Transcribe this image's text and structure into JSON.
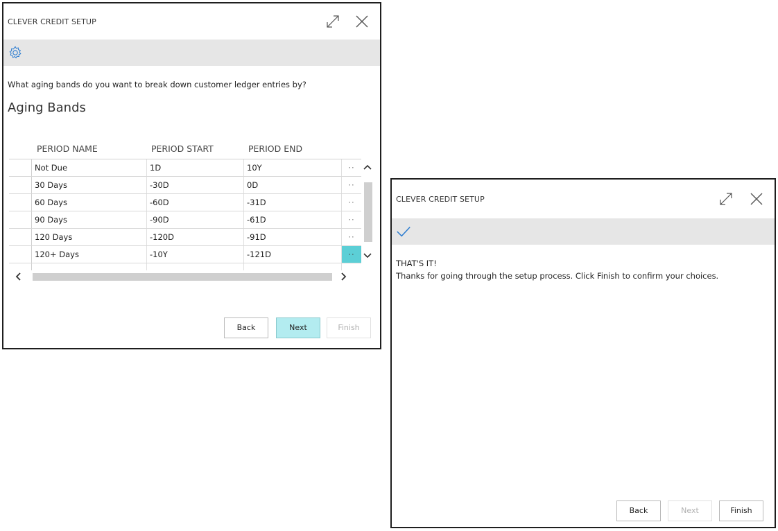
{
  "dialog1": {
    "title": "CLEVER CREDIT SETUP",
    "band_icon": "gear-icon",
    "question": "What aging bands do you want to break down customer ledger entries by?",
    "section_heading": "Aging Bands",
    "columns": [
      "PERIOD NAME",
      "PERIOD START",
      "PERIOD END"
    ],
    "rows": [
      {
        "name": "Not Due",
        "start": "1D",
        "end": "10Y"
      },
      {
        "name": "30 Days",
        "start": "-30D",
        "end": "0D"
      },
      {
        "name": "60 Days",
        "start": "-60D",
        "end": "-31D"
      },
      {
        "name": "90 Days",
        "start": "-90D",
        "end": "-61D"
      },
      {
        "name": "120 Days",
        "start": "-120D",
        "end": "-91D"
      },
      {
        "name": "120+ Days",
        "start": "-10Y",
        "end": "-121D"
      }
    ],
    "row_menu": "··",
    "buttons": {
      "back": "Back",
      "next": "Next",
      "finish": "Finish"
    },
    "accent_color": "#5ccfd6"
  },
  "dialog2": {
    "title": "CLEVER CREDIT SETUP",
    "band_icon": "checkmark-icon",
    "heading": "THAT'S IT!",
    "message": "Thanks for going through the setup process. Click Finish to confirm your choices.",
    "buttons": {
      "back": "Back",
      "next": "Next",
      "finish": "Finish"
    },
    "check_color": "#2a7bd0"
  }
}
